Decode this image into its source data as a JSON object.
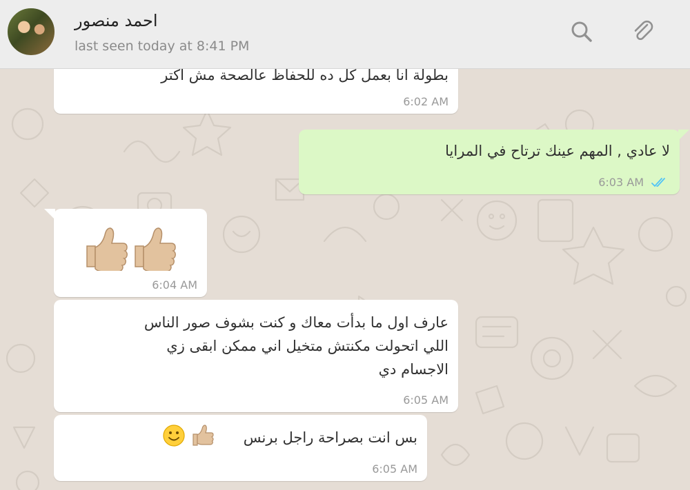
{
  "contact": {
    "name": "احمد منصور",
    "last_seen": "last seen today at 8:41 PM"
  },
  "icons": {
    "search": "search-icon",
    "attach": "paperclip-icon",
    "read_receipt": "double-check-icon",
    "thumbs_up": "thumbs-up-emoji",
    "smile": "slightly-smiling-face-emoji"
  },
  "colors": {
    "outgoing_bubble": "#dcf8c6",
    "incoming_bubble": "#ffffff",
    "read_ticks": "#4fc3f7",
    "header_bg": "#ededed",
    "chat_bg": "#e5ddd5"
  },
  "messages": [
    {
      "direction": "incoming",
      "text": "بطولة انا بعمل كل ده للحفاظ عالصحة مش اكتر",
      "time": "6:02 AM"
    },
    {
      "direction": "outgoing",
      "text": "لا عادي , المهم عينك ترتاح في المرايا",
      "time": "6:03 AM",
      "status": "read"
    },
    {
      "direction": "incoming",
      "emoji": "👍🏼👍🏼",
      "time": "6:04 AM"
    },
    {
      "direction": "incoming",
      "lines": [
        "عارف اول ما بدأت معاك و كنت بشوف صور الناس",
        "اللي اتحولت مكنتش متخيل اني ممكن ابقى زي",
        "الاجسام دي"
      ],
      "time": "6:05 AM"
    },
    {
      "direction": "incoming",
      "text": "بس انت بصراحة راجل برنس",
      "emoji": "👍🏼🙂",
      "time": "6:05 AM"
    }
  ]
}
